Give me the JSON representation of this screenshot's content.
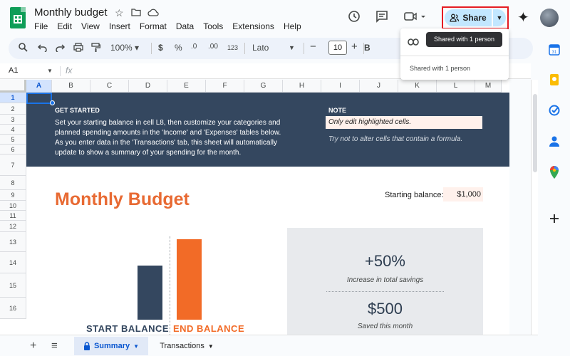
{
  "app": {
    "doc_title": "Monthly budget",
    "menus": [
      "File",
      "Edit",
      "View",
      "Insert",
      "Format",
      "Data",
      "Tools",
      "Extensions",
      "Help"
    ],
    "share_label": "Share",
    "tooltip": "Shared with 1 person",
    "popup_text": "Shared with 1 person"
  },
  "toolbar": {
    "zoom": "100%",
    "currency": "$",
    "percent": "%",
    "dec_less": ".0",
    "dec_more": ".00",
    "number_format": "123",
    "font": "Lato",
    "font_size": "10",
    "bold": "B"
  },
  "formula": {
    "cell_ref": "A1",
    "fx": "fx"
  },
  "columns": [
    "A",
    "B",
    "C",
    "D",
    "E",
    "F",
    "G",
    "H",
    "I",
    "J",
    "K",
    "L",
    "M"
  ],
  "rows": [
    "1",
    "2",
    "3",
    "4",
    "5",
    "6",
    "7",
    "8",
    "9",
    "10",
    "11",
    "12",
    "13",
    "14",
    "15",
    "16"
  ],
  "banner": {
    "get_started": "GET STARTED",
    "para1": "Set your starting balance in cell L8, then customize your categories and planned spending amounts in the 'Income' and 'Expenses' tables below.",
    "para2": "As you enter data in the 'Transactions' tab, this sheet will automatically update to show a summary of your spending for the month.",
    "note": "NOTE",
    "note_box": "Only edit highlighted cells.",
    "note_sub": "Try not to alter cells that contain a formula."
  },
  "budget": {
    "title": "Monthly Budget",
    "starting_label": "Starting balance:",
    "starting_value": "$1,000",
    "start_label": "START BALANCE",
    "end_label": "END BALANCE",
    "bars": {
      "start_fraction": 0.67,
      "end_fraction": 1.0
    },
    "colors": {
      "start": "#34475f",
      "end": "#f26b27",
      "accent": "#e86a33"
    }
  },
  "summary": {
    "pct": "+50%",
    "pct_label": "Increase in total savings",
    "saved": "$500",
    "saved_label": "Saved this month"
  },
  "sheets": {
    "active": "Summary",
    "other": "Transactions"
  }
}
